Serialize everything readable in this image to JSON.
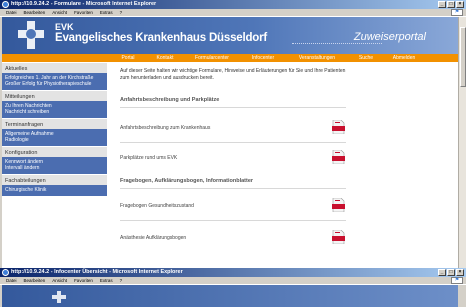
{
  "window1": {
    "title": "http://10.9.24.2 - Formulare - Microsoft Internet Explorer",
    "menu": [
      "Datei",
      "Bearbeiten",
      "Ansicht",
      "Favoriten",
      "Extras",
      "?"
    ],
    "window_buttons": [
      "_",
      "□",
      "×"
    ]
  },
  "header": {
    "short_name": "EVK",
    "org_name": "Evangelisches Krankenhaus Düsseldorf",
    "portal_label": "Zuweiserportal"
  },
  "nav": {
    "items": [
      "Portal",
      "Kontakt",
      "Formularcenter",
      "Infocenter",
      "Veranstaltungen",
      "Suche",
      "Abmelden"
    ]
  },
  "sidebar": {
    "sections": [
      {
        "heading": "Aktuelles",
        "links": [
          "Erfolgreiches 1. Jahr an der Kirchstraße",
          "Großer Erfolg für Physiotherapieschule"
        ]
      },
      {
        "heading": "Mitteilungen",
        "links": [
          "Zu Ihren Nachrichten",
          "Nachricht schreiben"
        ]
      },
      {
        "heading": "Terminanfragen",
        "links": [
          "Allgemeine Aufnahme",
          "Radiologie"
        ]
      },
      {
        "heading": "Konfiguration",
        "links": [
          "Kennwort ändern",
          "Intervall ändern"
        ]
      },
      {
        "heading": "Fachabteilungen",
        "links": [
          "Chirurgische Klinik"
        ]
      }
    ]
  },
  "content": {
    "intro": "Auf dieser Seite halten wir wichtige Formulare, Hinweise und Erläuterungen für Sie und Ihre Patienten zum herunterladen und ausdrucken bereit.",
    "section1": {
      "title": "Anfahrtsbeschreibung und Parkplätze",
      "rows": [
        "Anfahrtsbeschreibung zum Krankenhaus",
        "Parkplätze rund ums EVK"
      ]
    },
    "section2": {
      "title": "Fragebogen, Aufklärungsbogen, Informationblatter",
      "rows": [
        "Fragebogen Gesundheitszustand",
        "Anästhesie Aufklärungsbogen"
      ]
    },
    "pdf_icon": "pdf-file-icon"
  },
  "window2": {
    "title": "http://10.9.24.2 - Infocenter Übersicht - Microsoft Internet Explorer",
    "menu": [
      "Datei",
      "Bearbeiten",
      "Ansicht",
      "Favoriten",
      "Extras",
      "?"
    ]
  },
  "colors": {
    "banner": "#4f76b8",
    "nav": "#f29100",
    "sidebar_links": "#4b6db0",
    "title_bar": "#0a246a"
  }
}
